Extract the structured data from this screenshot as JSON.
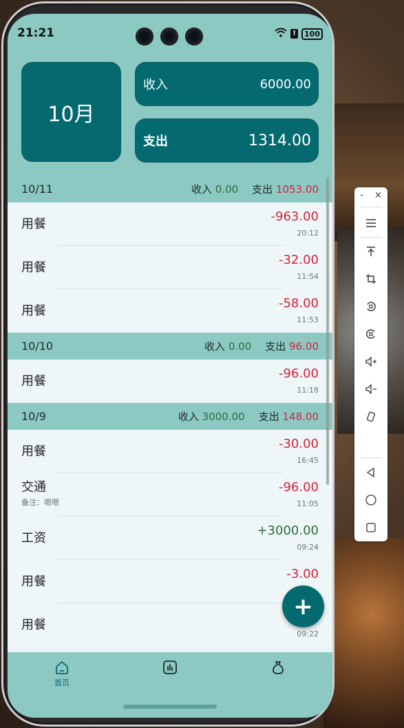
{
  "status_bar": {
    "time": "21:21",
    "battery": "100"
  },
  "summary": {
    "month": "10月",
    "income_label": "收入",
    "income_value": "6000.00",
    "expense_label": "支出",
    "expense_value": "1314.00"
  },
  "days": [
    {
      "date": "10/11",
      "income_label": "收入",
      "income": "0.00",
      "expense_label": "支出",
      "expense": "1053.00",
      "entries": [
        {
          "category": "用餐",
          "amount": "-963.00",
          "time": "20:12"
        },
        {
          "category": "用餐",
          "amount": "-32.00",
          "time": "11:54"
        },
        {
          "category": "用餐",
          "amount": "-58.00",
          "time": "11:53"
        }
      ]
    },
    {
      "date": "10/10",
      "income_label": "收入",
      "income": "0.00",
      "expense_label": "支出",
      "expense": "96.00",
      "entries": [
        {
          "category": "用餐",
          "amount": "-96.00",
          "time": "11:18"
        }
      ]
    },
    {
      "date": "10/9",
      "income_label": "收入",
      "income": "3000.00",
      "expense_label": "支出",
      "expense": "148.00",
      "entries": [
        {
          "category": "用餐",
          "amount": "-30.00",
          "time": "16:45"
        },
        {
          "category": "交通",
          "note": "备注：嗯嗯",
          "amount": "-96.00",
          "time": "11:05"
        },
        {
          "category": "工资",
          "amount": "+3000.00",
          "time": "09:24"
        },
        {
          "category": "用餐",
          "amount": "-3.00",
          "time": ""
        },
        {
          "category": "用餐",
          "amount": "",
          "time": "09:22"
        }
      ]
    }
  ],
  "fab": {
    "label": "+"
  },
  "nav": {
    "home_label": "首页",
    "items": [
      {
        "name": "home-icon"
      },
      {
        "name": "chart-icon"
      },
      {
        "name": "bag-icon"
      }
    ]
  },
  "toolbar": {
    "items": [
      "minimize-icon",
      "close-icon",
      "menu-icon",
      "pin-top-icon",
      "crop-icon",
      "rotate-left-icon",
      "rotate-right-icon",
      "volume-up-icon",
      "volume-down-icon",
      "shake-icon",
      "back-icon",
      "home-circle-icon",
      "recents-icon"
    ],
    "minimize": "-",
    "close": "×"
  },
  "colors": {
    "primary": "#046a70",
    "background": "#8cc9c3",
    "negative": "#d3243b",
    "positive": "#2e6b3a"
  }
}
